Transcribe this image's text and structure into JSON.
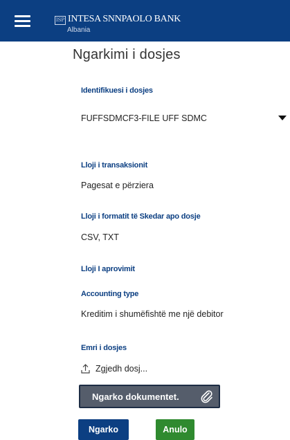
{
  "header": {
    "menu_icon": "hamburger-icon",
    "logo_mark": "ISP",
    "brand": "INTESA SNNPAOLO BANK",
    "brand_sub": "Albania",
    "background_color": "#0c3f82"
  },
  "page": {
    "title": "Ngarkimi i dosjes"
  },
  "form": {
    "file_id": {
      "label": "Identifikuesi i dosjes",
      "selected": "FUFFSDMCF3-FILE UFF SDMC"
    },
    "transaction_type": {
      "label": "Lloji i transaksionit",
      "value": "Pagesat e përziera"
    },
    "file_format": {
      "label": "Lloji i formatit të Skedar apo dosje",
      "value": "CSV, TXT"
    },
    "approval_type": {
      "label": "Lloji I aprovimit"
    },
    "accounting_type": {
      "label": "Accounting type",
      "value": "Kreditim i shumëfishtë me një debitor"
    },
    "file_name": {
      "label": "Emri i dosjes",
      "choose_text": "Zgjedh dosj..."
    },
    "upload_documents_label": "Ngarko dokumentet.",
    "submit_label": "Ngarko",
    "cancel_label": "Anulo"
  },
  "colors": {
    "primary": "#0c3f82",
    "cancel": "#2f8a2f",
    "doc_button": "#555d6b"
  }
}
